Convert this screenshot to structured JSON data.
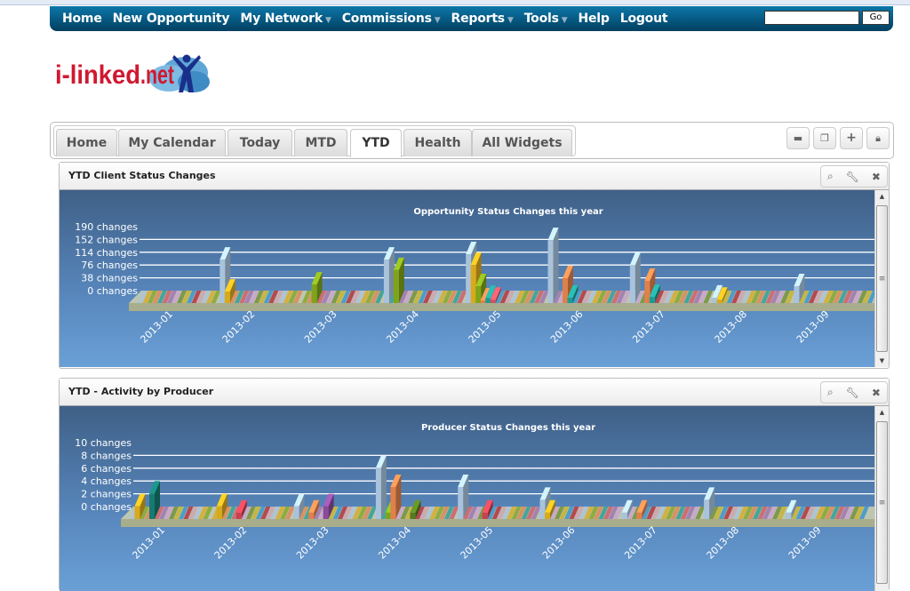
{
  "nav": {
    "items": [
      {
        "label": "Home",
        "dropdown": false
      },
      {
        "label": "New Opportunity",
        "dropdown": false
      },
      {
        "label": "My Network",
        "dropdown": true
      },
      {
        "label": "Commissions",
        "dropdown": true
      },
      {
        "label": "Reports",
        "dropdown": true
      },
      {
        "label": "Tools",
        "dropdown": true
      },
      {
        "label": "Help",
        "dropdown": false
      },
      {
        "label": "Logout",
        "dropdown": false
      }
    ],
    "search_value": "",
    "go_label": "Go",
    "caret": "▼"
  },
  "logo": {
    "text_red": "i-linked",
    "text_blue": ".net"
  },
  "tabs": {
    "items": [
      "Home",
      "My Calendar",
      "Today",
      "MTD",
      "YTD",
      "Health",
      "All Widgets"
    ],
    "active": "YTD",
    "tools": [
      "open-folder-icon",
      "copy-icon",
      "plus-icon",
      "lock-icon"
    ]
  },
  "widgets": [
    {
      "title": "YTD Client Status Changes",
      "tools": [
        "zoom-icon",
        "wrench-icon",
        "close-icon"
      ]
    },
    {
      "title": "YTD - Activity by Producer",
      "tools": [
        "zoom-icon",
        "wrench-icon",
        "close-icon"
      ]
    }
  ],
  "chart_data": [
    {
      "type": "bar",
      "title": "Opportunity Status Changes this year",
      "categories": [
        "2013-01",
        "2013-02",
        "2013-03",
        "2013-04",
        "2013-05",
        "2013-06",
        "2013-07",
        "2013-08",
        "2013-09"
      ],
      "yticks": [
        "0 changes",
        "38 changes",
        "76 changes",
        "114 changes",
        "152 changes",
        "190 changes"
      ],
      "ylim": [
        0,
        190
      ],
      "grid": true,
      "series": [
        {
          "color": "#a9c3dc",
          "values": [
            0,
            129,
            0,
            129,
            145,
            187,
            113,
            16,
            50
          ]
        },
        {
          "color": "#d9a91c",
          "values": [
            0,
            34,
            0,
            0,
            113,
            0,
            0,
            10,
            0
          ]
        },
        {
          "color": "#7fa31a",
          "values": [
            0,
            0,
            55,
            98,
            50,
            0,
            0,
            0,
            0
          ]
        },
        {
          "color": "#e0804a",
          "values": [
            0,
            0,
            0,
            0,
            8,
            74,
            66,
            0,
            0
          ]
        },
        {
          "color": "#1f9a93",
          "values": [
            0,
            0,
            0,
            0,
            15,
            16,
            18,
            0,
            0
          ]
        },
        {
          "color": "#d05060",
          "values": [
            0,
            0,
            0,
            0,
            10,
            0,
            0,
            0,
            0
          ]
        }
      ]
    },
    {
      "type": "bar",
      "title": "Producer Status Changes this year",
      "categories": [
        "2013-01",
        "2013-02",
        "2013-03",
        "2013-04",
        "2013-05",
        "2013-06",
        "2013-07",
        "2013-08",
        "2013-09"
      ],
      "yticks": [
        "0 changes",
        "2 changes",
        "4 changes",
        "6 changes",
        "8 changes",
        "10 changes"
      ],
      "ylim": [
        0,
        10
      ],
      "grid": true,
      "series": [
        {
          "color": "#a9c3dc",
          "values": [
            0,
            0,
            2,
            8,
            5,
            3,
            1,
            3,
            1
          ]
        },
        {
          "color": "#d9a91c",
          "values": [
            2,
            2,
            0,
            0,
            0,
            1,
            0,
            0,
            0
          ]
        },
        {
          "color": "#7fa31a",
          "values": [
            0,
            0,
            0,
            1,
            0,
            0,
            0,
            0,
            0
          ]
        },
        {
          "color": "#e0804a",
          "values": [
            0,
            0,
            1,
            5,
            0,
            0,
            1,
            0,
            0
          ]
        },
        {
          "color": "#157a70",
          "values": [
            4,
            0,
            0,
            0,
            0,
            0,
            0,
            0,
            0
          ]
        },
        {
          "color": "#c94050",
          "values": [
            0,
            1,
            0,
            0,
            1,
            0,
            0,
            0,
            0
          ]
        },
        {
          "color": "#8a4a9a",
          "values": [
            0,
            0,
            2,
            0,
            0,
            0,
            0,
            0,
            0
          ]
        },
        {
          "color": "#557a20",
          "values": [
            0,
            0,
            0,
            1,
            0,
            0,
            0,
            0,
            0
          ]
        }
      ]
    }
  ]
}
